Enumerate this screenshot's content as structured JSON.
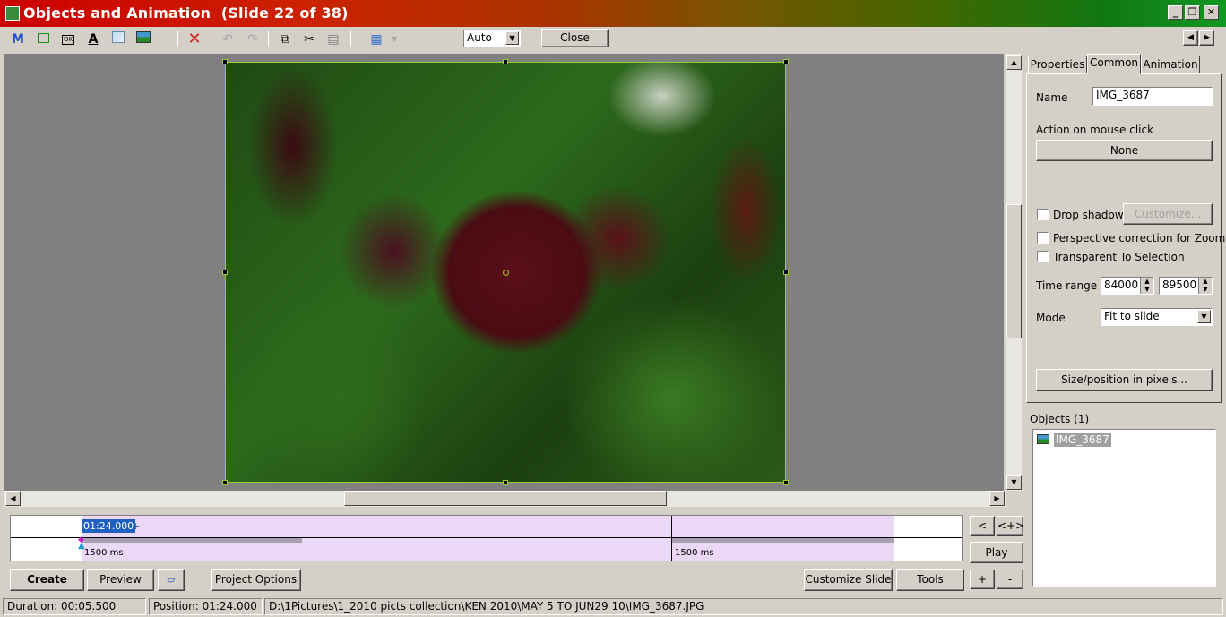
{
  "window": {
    "title": "Objects and Animation  (Slide 22 of 38)",
    "controls": [
      "minimize",
      "restore",
      "close"
    ]
  },
  "toolbar": {
    "icons": [
      "mask-icon",
      "rectangle-icon",
      "button-icon",
      "text-icon",
      "frame-icon",
      "image-icon",
      "delete-icon",
      "undo-icon",
      "redo-icon",
      "copy-icon",
      "cut-icon",
      "paste-icon",
      "grid-icon"
    ],
    "zoom_value": "Auto",
    "close_label": "Close"
  },
  "panel": {
    "tabs": [
      "Properties",
      "Common",
      "Animation"
    ],
    "active_tab": "Common",
    "name_label": "Name",
    "name_value": "IMG_3687",
    "action_label": "Action on mouse click",
    "action_value": "None",
    "drop_shadow_label": "Drop shadow",
    "customize_label": "Customize...",
    "perspective_label": "Perspective correction for Zoom",
    "transparent_label": "Transparent To Selection",
    "time_range_label": "Time range",
    "time_start": "84000",
    "time_end": "89500",
    "mode_label": "Mode",
    "mode_value": "Fit to slide",
    "size_button": "Size/position in pixels...",
    "objects_label": "Objects (1)",
    "objects": [
      "IMG_3687"
    ]
  },
  "timeline": {
    "position_label": "01:24.000",
    "left_duration": "1500 ms",
    "right_duration": "1500 ms",
    "prev_label": "<",
    "add_label": "<+>",
    "play_label": "Play",
    "plus_label": "+",
    "minus_label": "-"
  },
  "bottom_buttons": {
    "create": "Create",
    "preview": "Preview",
    "project_options": "Project Options",
    "customize_slide": "Customize Slide",
    "tools": "Tools"
  },
  "status": {
    "duration": "Duration:  00:05.500",
    "position": "Position:  01:24.000",
    "path": "D:\\1Pictures\\1_2010 picts collection\\KEN 2010\\MAY 5 TO JUN29 10\\IMG_3687.JPG"
  }
}
